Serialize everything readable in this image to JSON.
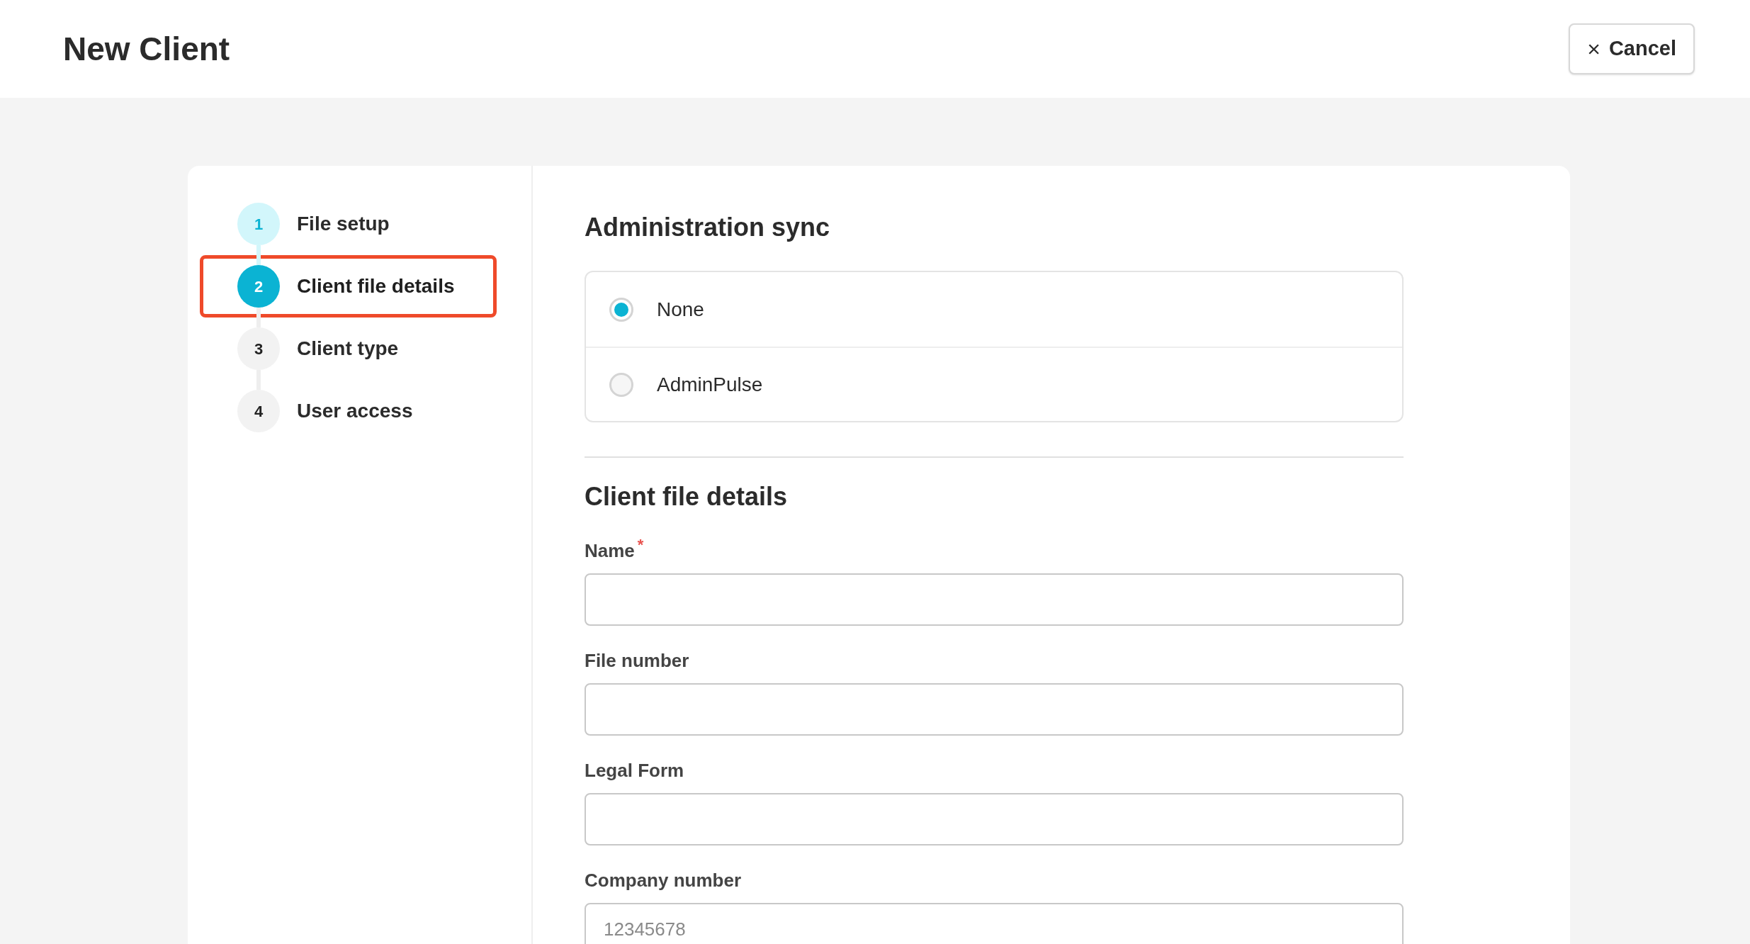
{
  "header": {
    "title": "New Client",
    "cancel_button": {
      "icon": "×",
      "label": "Cancel"
    }
  },
  "steps": [
    {
      "number": "1",
      "label": "File setup",
      "completed": true,
      "selected": false,
      "highlighted": false
    },
    {
      "number": "2",
      "label": "Client file details",
      "completed": false,
      "selected": true,
      "highlighted": true
    },
    {
      "number": "3",
      "label": "Client type",
      "completed": false,
      "selected": false,
      "highlighted": false
    },
    {
      "number": "4",
      "label": "User access",
      "completed": false,
      "selected": false,
      "highlighted": false
    }
  ],
  "administration_sync": {
    "heading": "Administration sync",
    "options": [
      {
        "label": "None",
        "selected": true
      },
      {
        "label": "AdminPulse",
        "selected": false
      }
    ]
  },
  "client_file_details": {
    "heading": "Client file details",
    "fields": [
      {
        "label": "Name",
        "required_mark": "*"
      },
      {
        "label": "File number"
      },
      {
        "label": "Legal Form"
      },
      {
        "label": "Company number",
        "placeholder": "12345678"
      }
    ]
  }
}
